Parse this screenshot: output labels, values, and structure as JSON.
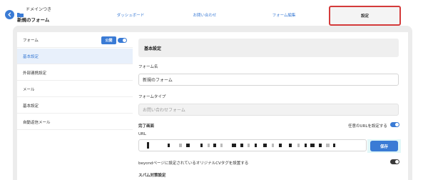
{
  "header": {
    "breadcrumb": "ドメインつき",
    "form_title": "新規のフォーム",
    "tabs": [
      {
        "label": "ダッシュボード"
      },
      {
        "label": "お問い合わせ"
      },
      {
        "label": "フォーム編集"
      },
      {
        "label": "設定",
        "active": true
      }
    ]
  },
  "sidebar": {
    "form_label": "フォーム",
    "public_badge": "公開",
    "items": [
      {
        "label": "基本設定",
        "active": true
      },
      {
        "label": "外部連携設定"
      },
      {
        "label": "メール"
      },
      {
        "label": "基本設定"
      },
      {
        "label": "自動返信メール"
      }
    ]
  },
  "main": {
    "section_title": "基本設定",
    "form_name_label": "フォーム名",
    "form_name_value": "新規のフォーム",
    "form_type_label": "フォームタイプ",
    "form_type_value": "お問い合わせフォーム",
    "complete_label": "完了画面",
    "custom_url_label": "任意のURLを設定する",
    "url_label": "URL",
    "save_label": "保存",
    "cv_tag_label": "beyondページに設定されているオリジナルCVタグを設置する",
    "spam_label": "スパム対策設定"
  },
  "colors": {
    "accent": "#3a7bd5",
    "highlight_border": "#d43a3a",
    "save_area_bg": "#e1f7f8"
  }
}
